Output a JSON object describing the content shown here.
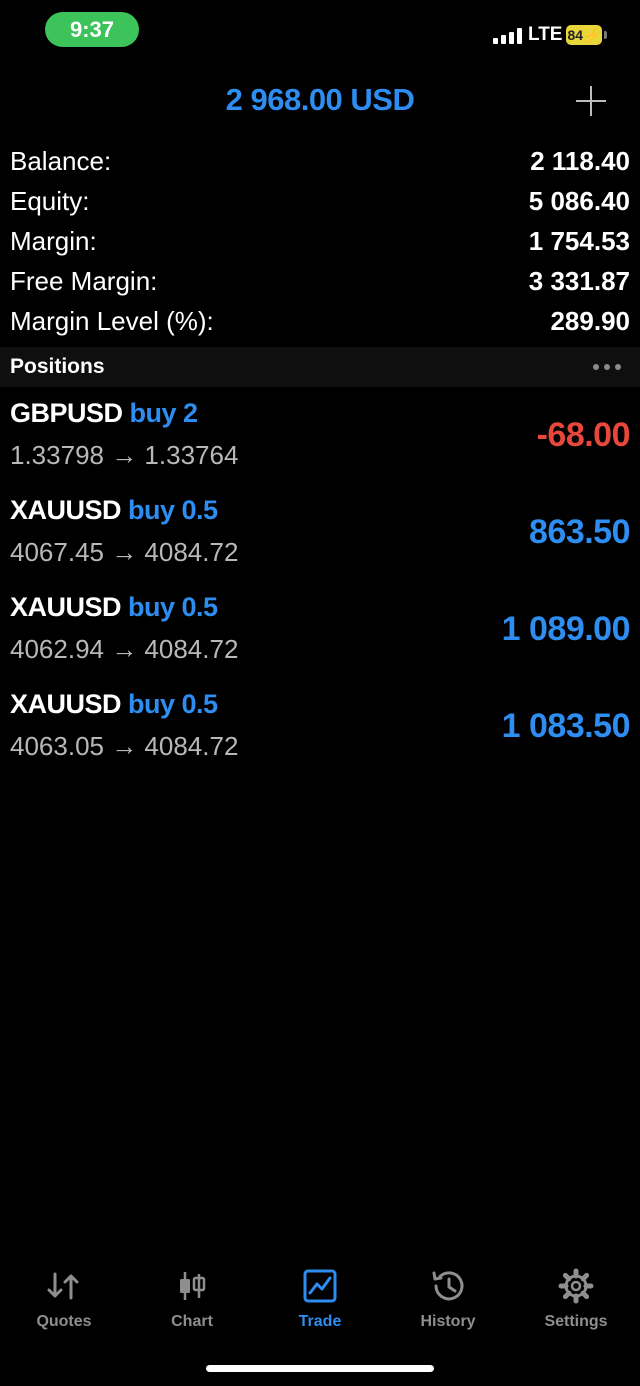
{
  "status_bar": {
    "time": "9:37",
    "network": "LTE",
    "battery": "84"
  },
  "header": {
    "title": "2 968.00 USD"
  },
  "summary": [
    {
      "label": "Balance:",
      "value": "2 118.40"
    },
    {
      "label": "Equity:",
      "value": "5 086.40"
    },
    {
      "label": "Margin:",
      "value": "1 754.53"
    },
    {
      "label": "Free Margin:",
      "value": "3 331.87"
    },
    {
      "label": "Margin Level (%):",
      "value": "289.90"
    }
  ],
  "positions_section": {
    "title": "Positions"
  },
  "positions": [
    {
      "symbol": "GBPUSD",
      "side": "buy 2",
      "prices": "1.33798 → 1.33764",
      "profit": "-68.00",
      "profit_color": "#e8473b"
    },
    {
      "symbol": "XAUUSD",
      "side": "buy 0.5",
      "prices": "4067.45 → 4084.72",
      "profit": "863.50",
      "profit_color": "#2d8df0"
    },
    {
      "symbol": "XAUUSD",
      "side": "buy 0.5",
      "prices": "4062.94 → 4084.72",
      "profit": "1 089.00",
      "profit_color": "#2d8df0"
    },
    {
      "symbol": "XAUUSD",
      "side": "buy 0.5",
      "prices": "4063.05 → 4084.72",
      "profit": "1 083.50",
      "profit_color": "#2d8df0"
    }
  ],
  "tabs": [
    {
      "label": "Quotes",
      "icon": "quotes-icon",
      "active": false
    },
    {
      "label": "Chart",
      "icon": "chart-icon",
      "active": false
    },
    {
      "label": "Trade",
      "icon": "trade-icon",
      "active": true
    },
    {
      "label": "History",
      "icon": "history-icon",
      "active": false
    },
    {
      "label": "Settings",
      "icon": "settings-icon",
      "active": false
    }
  ],
  "colors": {
    "accent": "#2d8df0",
    "loss": "#e8473b",
    "background": "#000000"
  }
}
